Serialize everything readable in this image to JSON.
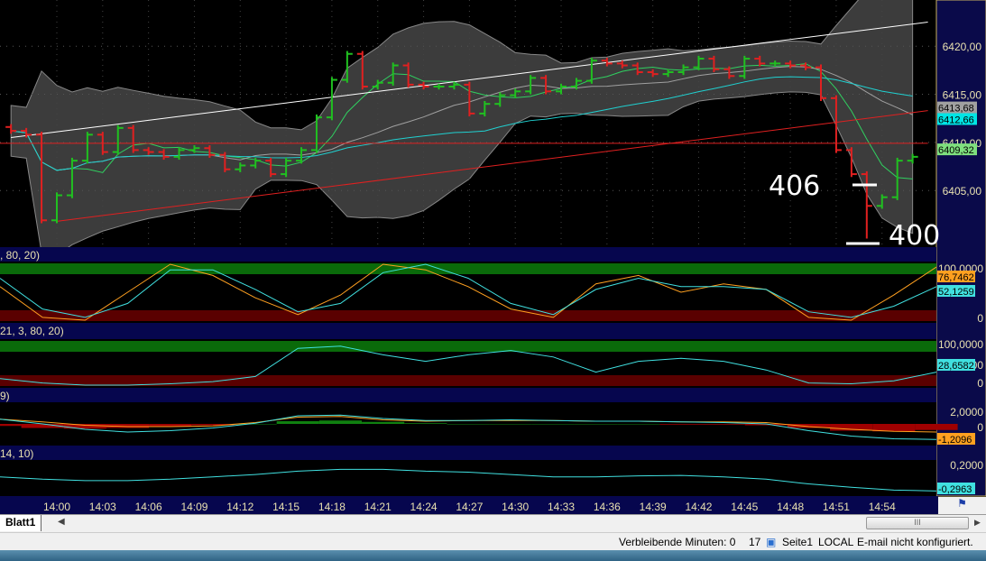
{
  "chart_data": {
    "type": "ohlc",
    "title": "",
    "time_labels": [
      "14:00",
      "14:03",
      "14:06",
      "14:09",
      "14:12",
      "14:15",
      "14:18",
      "14:21",
      "14:24",
      "14:27",
      "14:30",
      "14:33",
      "14:36",
      "14:39",
      "14:42",
      "14:45",
      "14:48",
      "14:51",
      "14:54"
    ],
    "first_bar_minute_offset": -3,
    "closes": [
      6411.2,
      6410.8,
      6401.9,
      6404.5,
      6408.1,
      6410.8,
      6409.0,
      6411.5,
      6409.2,
      6409.0,
      6408.5,
      6409.2,
      6409.4,
      6408.7,
      6407.2,
      6407.6,
      6408.1,
      6406.7,
      6408.1,
      6409.2,
      6412.6,
      6416.5,
      6419.2,
      6415.8,
      6416.2,
      6418.0,
      6416.0,
      6415.8,
      6415.8,
      6416.0,
      6413.0,
      6414.0,
      6414.9,
      6415.3,
      6416.7,
      6415.3,
      6415.8,
      6416.4,
      6418.5,
      6418.2,
      6418.0,
      6417.3,
      6417.1,
      6417.3,
      6417.8,
      6418.7,
      6417.6,
      6416.9,
      6418.7,
      6418.2,
      6418.2,
      6418.0,
      6417.8,
      6414.6,
      6409.2,
      6406.7,
      6403.4,
      6404.3,
      6408.1,
      6408.5
    ],
    "lows_override": {
      "56": 6400.0
    },
    "y_ticks": [
      "6420,00",
      "6415,00",
      "6410,00",
      "6405,00"
    ],
    "ylim": [
      6399.3,
      6424.8
    ],
    "last_values": [
      {
        "label": "6413,68",
        "color": "#a0a0a0"
      },
      {
        "label": "6412,66",
        "color": "#00e5e5"
      },
      {
        "label": "6409,32",
        "color": "#7ee07e"
      }
    ],
    "trendlines": [
      {
        "color": "#ffffff",
        "from": [
          -3,
          6410.5
        ],
        "to": [
          57,
          6422.5
        ]
      },
      {
        "color": "#e02020",
        "from": [
          0,
          6401.8
        ],
        "to": [
          57,
          6413.3
        ]
      },
      {
        "color": "#e02020",
        "from": [
          -4,
          6409.9
        ],
        "to": [
          57,
          6409.9
        ]
      }
    ],
    "annotations": [
      {
        "text": "406",
        "color": "#ffffff"
      },
      {
        "text": "400",
        "color": "#ffffff"
      }
    ]
  },
  "indicators": [
    {
      "header": ", 80, 20)",
      "ticks": [
        "100,0000",
        "0"
      ],
      "range": [
        0,
        100
      ],
      "bands": true,
      "series": [
        {
          "color": "#ffa020",
          "values": [
            60,
            5,
            0,
            50,
            100,
            80,
            40,
            10,
            45,
            100,
            90,
            60,
            20,
            5,
            65,
            80,
            50,
            65,
            55,
            5,
            0,
            45,
            95
          ]
        },
        {
          "color": "#40e0e0",
          "values": [
            75,
            20,
            5,
            30,
            90,
            90,
            55,
            15,
            30,
            85,
            100,
            75,
            30,
            10,
            55,
            75,
            60,
            60,
            55,
            15,
            5,
            25,
            60
          ]
        }
      ],
      "labels": [
        {
          "text": "76,7462",
          "bg": "#ffa020"
        },
        {
          "text": "52,1259",
          "bg": "#40e0e0"
        }
      ]
    },
    {
      "header": "21, 3, 80, 20)",
      "ticks": [
        "100,0000",
        "50,0000",
        "0"
      ],
      "range": [
        0,
        100
      ],
      "bands": true,
      "series": [
        {
          "color": "#40e0e0",
          "values": [
            15,
            5,
            0,
            0,
            3,
            8,
            20,
            85,
            90,
            70,
            55,
            70,
            80,
            65,
            30,
            55,
            62,
            55,
            35,
            5,
            3,
            10,
            30
          ]
        }
      ],
      "labels": [
        {
          "text": "28,6582",
          "bg": "#40e0e0"
        }
      ]
    },
    {
      "header": "9)",
      "ticks": [
        "2,0000",
        "0"
      ],
      "range": [
        -2.8,
        2.8
      ],
      "bands": false,
      "histogram": [
        -0.3,
        -0.6,
        -0.7,
        -0.6,
        -0.4,
        -0.2,
        0,
        0.4,
        0.5,
        0.3,
        0.1,
        0,
        0,
        0,
        0,
        0,
        -0.1,
        -0.1,
        -0.2,
        -0.6,
        -1.0,
        -1.1,
        -0.9
      ],
      "series": [
        {
          "color": "#ffa020",
          "values": [
            0.7,
            0.3,
            -0.2,
            -0.4,
            -0.4,
            -0.3,
            0.2,
            1.0,
            1.1,
            0.6,
            0.4,
            0.5,
            0.5,
            0.5,
            0.4,
            0.4,
            0.3,
            0.3,
            0.2,
            -0.4,
            -0.8,
            -1.1,
            -1.2
          ]
        },
        {
          "color": "#40e0e0",
          "values": [
            0.7,
            0.0,
            -0.8,
            -1.2,
            -1.0,
            -0.6,
            0.1,
            1.2,
            1.3,
            0.8,
            0.5,
            0.5,
            0.6,
            0.5,
            0.4,
            0.4,
            0.3,
            0.2,
            0.0,
            -1.0,
            -1.8,
            -2.2,
            -2.3
          ]
        }
      ],
      "labels": [
        {
          "text": "-1,2096",
          "bg": "#ffa020"
        }
      ]
    },
    {
      "header": "14, 10)",
      "ticks": [
        "0,2000"
      ],
      "range": [
        -0.35,
        0.3
      ],
      "bands": false,
      "series": [
        {
          "color": "#40e0e0",
          "values": [
            0.0,
            -0.05,
            -0.08,
            -0.08,
            -0.05,
            0.0,
            0.05,
            0.12,
            0.16,
            0.16,
            0.12,
            0.1,
            0.05,
            0.0,
            0.0,
            0.02,
            0.03,
            0.0,
            -0.05,
            -0.15,
            -0.22,
            -0.28,
            -0.3
          ]
        }
      ],
      "labels": [
        {
          "text": "-0,2963",
          "bg": "#40e0e0"
        }
      ]
    }
  ],
  "sheet_tab": "Blatt1",
  "status": {
    "remaining": "Verbleibende Minuten: 0",
    "count": "17",
    "page": "Seite1",
    "mode": "LOCAL",
    "email": "E-mail nicht konfiguriert."
  },
  "scroll_thumb": "III"
}
